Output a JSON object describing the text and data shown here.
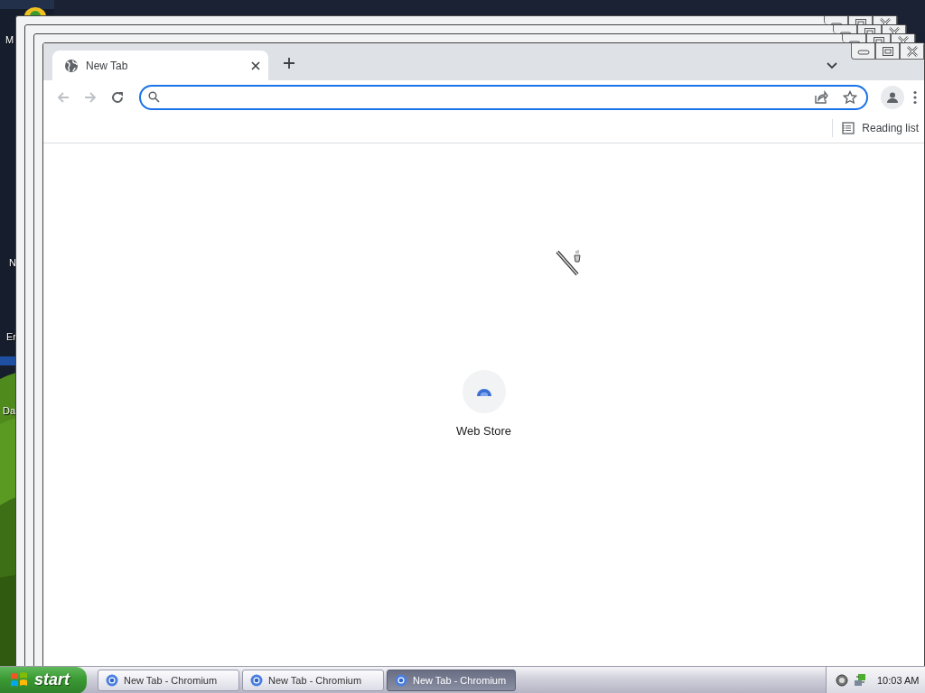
{
  "desktop": {
    "icon_labels": [
      "M",
      "N",
      "Er",
      "Da"
    ]
  },
  "browser": {
    "tabs": [
      {
        "title": "New Tab",
        "selected": true
      }
    ],
    "bookmarks_bar": {
      "reading_list": "Reading list"
    },
    "shortcuts": [
      {
        "label": "Web Store"
      }
    ]
  },
  "taskbar": {
    "start": "start",
    "buttons": [
      {
        "label": "New Tab - Chromium",
        "selected": false
      },
      {
        "label": "New Tab - Chromium",
        "selected": false
      },
      {
        "label": "New Tab - Chromium",
        "selected": true
      }
    ],
    "clock": "10:03 AM"
  }
}
